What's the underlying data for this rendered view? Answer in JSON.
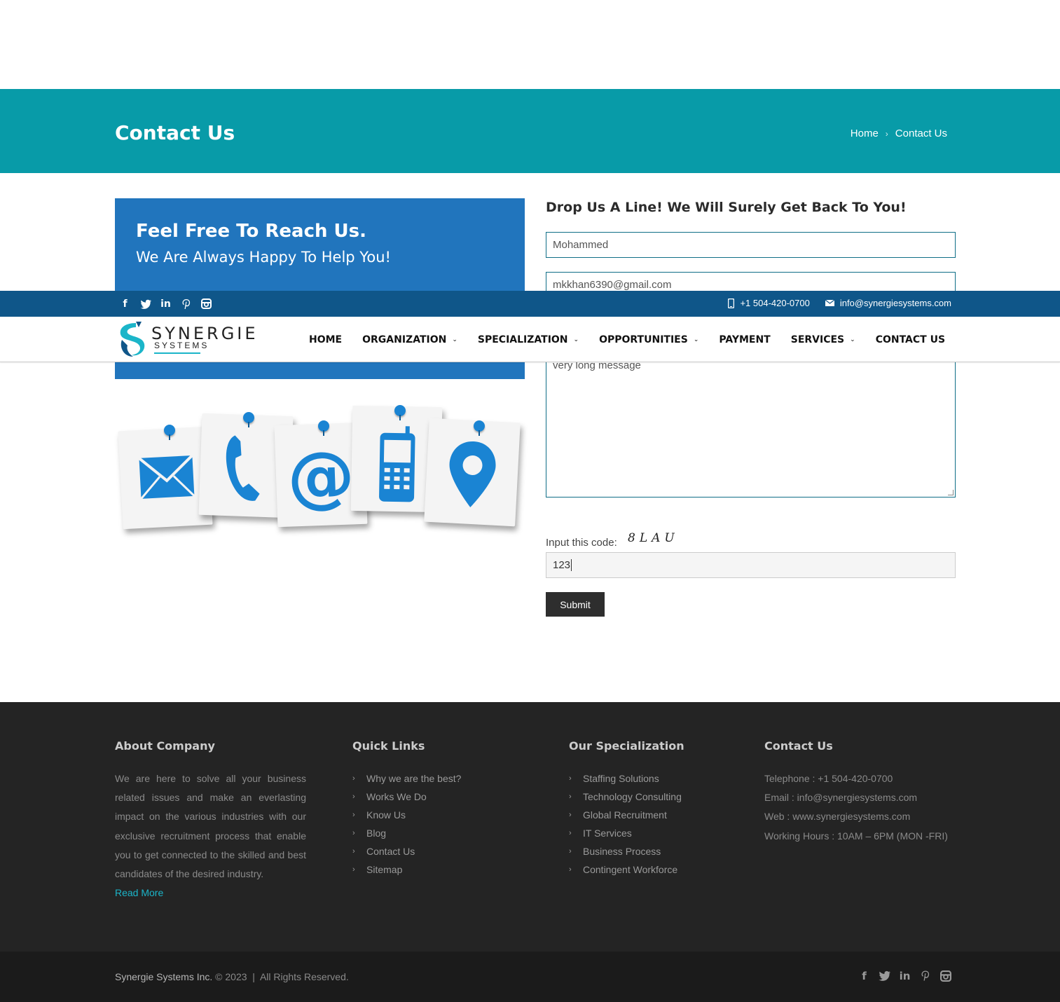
{
  "banner": {
    "title": "Contact Us",
    "breadcrumb": {
      "home": "Home",
      "sep": "›",
      "current": "Contact Us"
    }
  },
  "reach": {
    "title": "Feel Free To Reach Us.",
    "subtitle": "We Are Always Happy To Help You!"
  },
  "form": {
    "title": "Drop Us A Line! We Will Surely Get Back To You!",
    "name_value": "Mohammed",
    "email_value": "mkkhan6390@gmail.com",
    "message_value": "very long message",
    "captcha_label": "Input this code:",
    "captcha_code": "8LAU",
    "captcha_value": "123",
    "submit_label": "Submit"
  },
  "topbar": {
    "phone": "+1 504-420-0700",
    "email": "info@synergiesystems.com"
  },
  "logo": {
    "title": "SYNERGIE",
    "subtitle": "SYSTEMS"
  },
  "nav": {
    "items": [
      {
        "label": "HOME",
        "dropdown": false
      },
      {
        "label": "ORGANIZATION",
        "dropdown": true
      },
      {
        "label": "SPECIALIZATION",
        "dropdown": true
      },
      {
        "label": "OPPORTUNITIES",
        "dropdown": true
      },
      {
        "label": "PAYMENT",
        "dropdown": false
      },
      {
        "label": "SERVICES",
        "dropdown": true
      },
      {
        "label": "CONTACT US",
        "dropdown": false
      }
    ]
  },
  "footer": {
    "about": {
      "title": "About Company",
      "text": "We are here to solve all your business related issues and make an everlasting impact on the various industries with our exclusive recruitment process that enable you to get connected to the skilled and best candidates of the desired industry.",
      "read_more": "Read More"
    },
    "quick_links": {
      "title": "Quick Links",
      "items": [
        "Why we are the best?",
        "Works We Do",
        "Know Us",
        "Blog",
        "Contact Us",
        "Sitemap"
      ]
    },
    "specialization": {
      "title": "Our Specialization",
      "items": [
        "Staffing Solutions",
        "Technology Consulting",
        "Global Recruitment",
        "IT Services",
        "Business Process",
        "Contingent Workforce"
      ]
    },
    "contact": {
      "title": "Contact Us",
      "items": [
        "Telephone : +1 504-420-0700",
        "Email : info@synergiesystems.com",
        "Web : www.synergiesystems.com",
        "Working Hours : 10AM – 6PM (MON -FRI)"
      ]
    },
    "copyright_company": "Synergie Systems Inc.",
    "copyright_rest": " © 2023  |  All Rights Reserved."
  },
  "colors": {
    "banner": "#089ba8",
    "topbar": "#0f5689",
    "reach_box": "#2175bd",
    "footer": "#242424",
    "accent": "#1bb5c9"
  }
}
